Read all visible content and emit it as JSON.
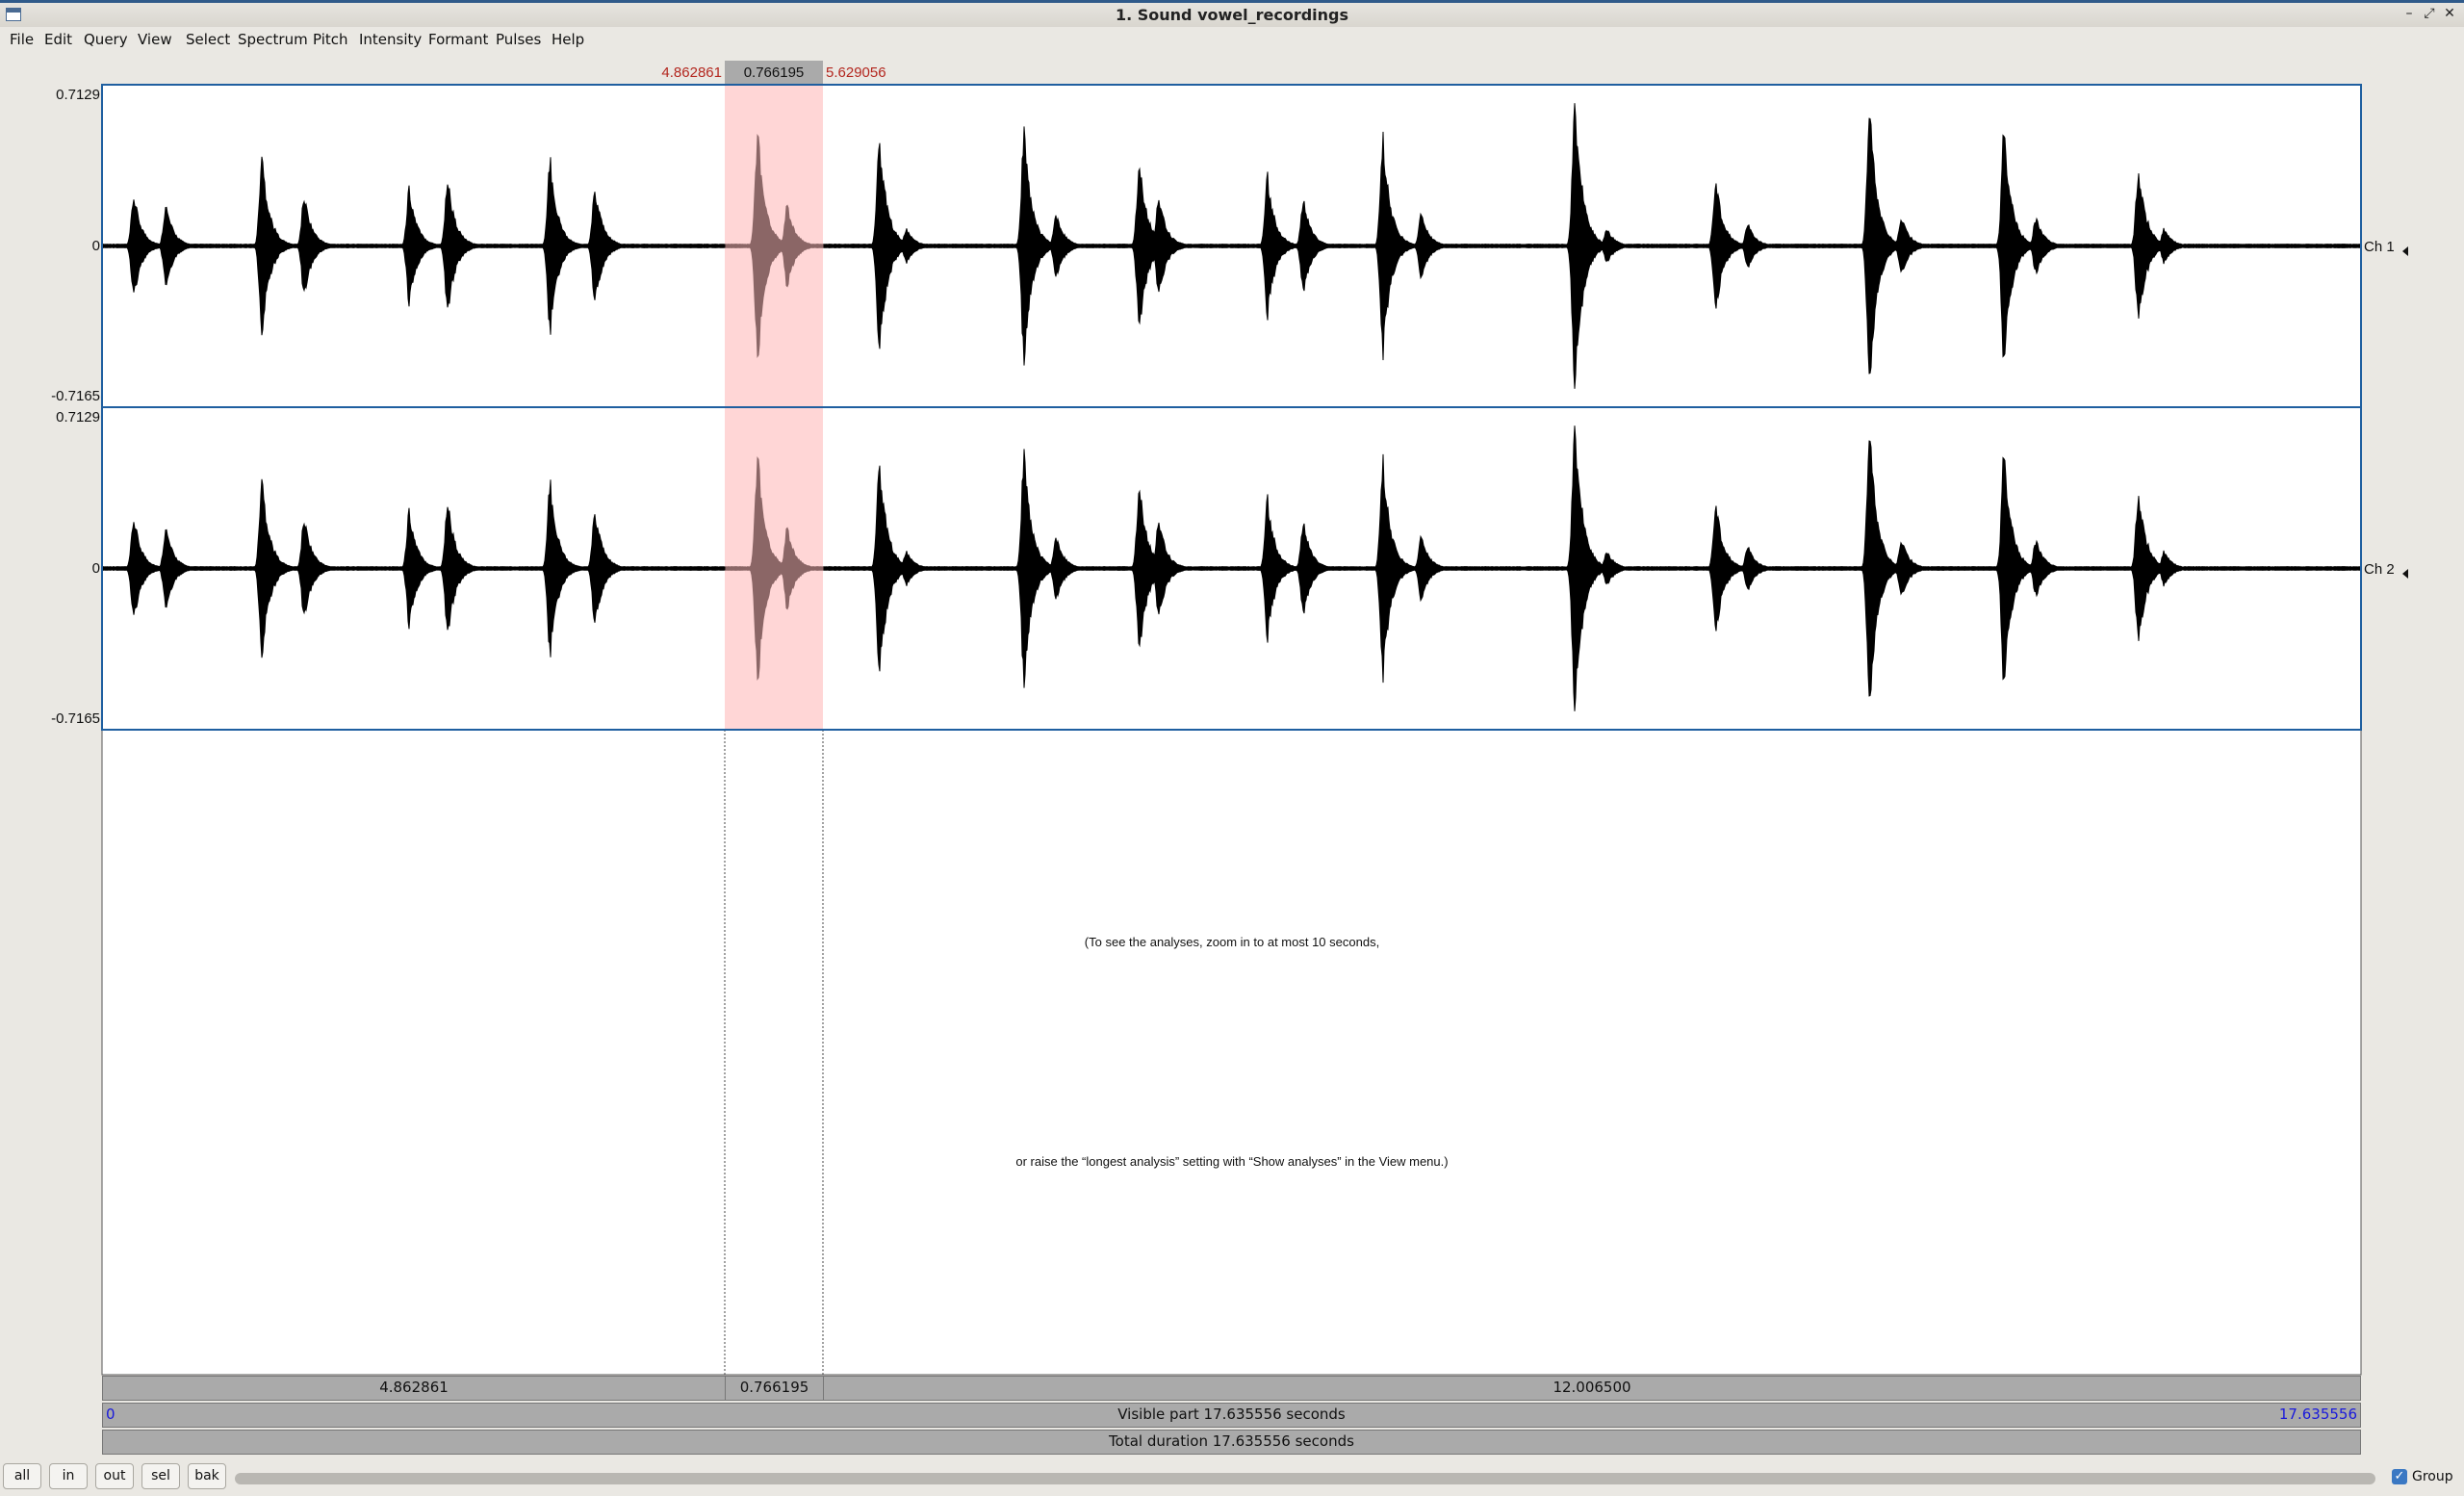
{
  "window": {
    "title": "1. Sound vowel_recordings",
    "controls": [
      "–",
      "⤢",
      "✕"
    ]
  },
  "menu": [
    "File",
    "Edit",
    "Query",
    "View",
    "Select",
    "Spectrum",
    "Pitch",
    "Intensity",
    "Formant",
    "Pulses",
    "Help"
  ],
  "selection": {
    "start": "4.862861",
    "duration": "0.766195",
    "end": "5.629056"
  },
  "channels": [
    {
      "label": "Ch 1",
      "max": "0.7129",
      "zero": "0",
      "min": "-0.7165"
    },
    {
      "label": "Ch 2",
      "max": "0.7129",
      "zero": "0",
      "min": "-0.7165"
    }
  ],
  "message": {
    "line1": "(To see the analyses, zoom in to at most 10 seconds,",
    "line2": "or raise the “longest analysis” setting with “Show analyses” in the View menu.)"
  },
  "time_bar": {
    "before": "4.862861",
    "selected": "0.766195",
    "after": "12.006500"
  },
  "visible_bar": {
    "start": "0",
    "label": "Visible part 17.635556 seconds",
    "end": "17.635556"
  },
  "total_bar": {
    "label": "Total duration 17.635556 seconds"
  },
  "buttons": [
    "all",
    "in",
    "out",
    "sel",
    "bak"
  ],
  "group": {
    "label": "Group",
    "checked": true
  },
  "colors": {
    "selection_fill": "#ffd6d6",
    "selection_time": "#b3261e",
    "channel_border": "#1f5fa0",
    "visible_numbers": "#1a1adb"
  },
  "waveform": {
    "duration_s": 17.635556,
    "bursts": [
      {
        "t": 0.25,
        "amp": 0.35
      },
      {
        "t": 0.5,
        "amp": 0.28
      },
      {
        "t": 1.25,
        "amp": 0.62
      },
      {
        "t": 1.58,
        "amp": 0.35
      },
      {
        "t": 2.4,
        "amp": 0.4
      },
      {
        "t": 2.7,
        "amp": 0.47
      },
      {
        "t": 3.5,
        "amp": 0.6
      },
      {
        "t": 3.85,
        "amp": 0.4
      },
      {
        "t": 5.12,
        "amp": 0.8
      },
      {
        "t": 5.35,
        "amp": 0.28
      },
      {
        "t": 6.07,
        "amp": 0.77
      },
      {
        "t": 6.28,
        "amp": 0.12
      },
      {
        "t": 7.2,
        "amp": 0.8
      },
      {
        "t": 7.45,
        "amp": 0.22
      },
      {
        "t": 8.1,
        "amp": 0.6
      },
      {
        "t": 8.25,
        "amp": 0.35
      },
      {
        "t": 9.1,
        "amp": 0.48
      },
      {
        "t": 9.38,
        "amp": 0.32
      },
      {
        "t": 10.0,
        "amp": 0.75
      },
      {
        "t": 10.3,
        "amp": 0.22
      },
      {
        "t": 11.5,
        "amp": 1.0
      },
      {
        "t": 11.75,
        "amp": 0.12
      },
      {
        "t": 12.6,
        "amp": 0.45
      },
      {
        "t": 12.85,
        "amp": 0.15
      },
      {
        "t": 13.8,
        "amp": 0.95
      },
      {
        "t": 14.05,
        "amp": 0.2
      },
      {
        "t": 14.85,
        "amp": 0.8
      },
      {
        "t": 15.1,
        "amp": 0.2
      },
      {
        "t": 15.9,
        "amp": 0.55
      },
      {
        "t": 16.1,
        "amp": 0.12
      }
    ]
  }
}
